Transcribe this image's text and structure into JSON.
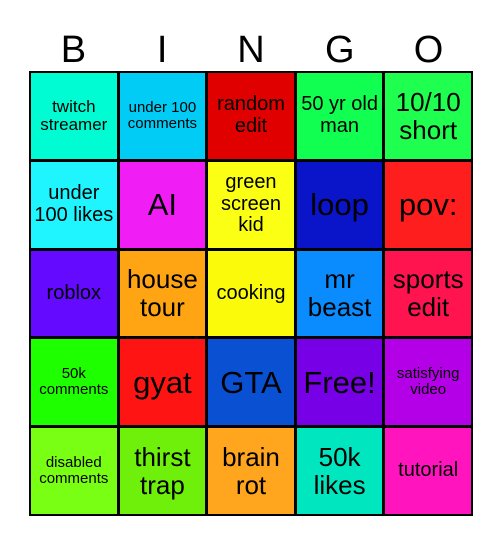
{
  "header": {
    "letters": [
      "B",
      "I",
      "N",
      "G",
      "O"
    ]
  },
  "cells": [
    {
      "text": "twitch streamer",
      "color": "#00FCD2",
      "size": "s-sm"
    },
    {
      "text": "under 100 comments",
      "color": "#00CCF5",
      "size": "s-xs"
    },
    {
      "text": "random edit",
      "color": "#E00000",
      "size": "s-md"
    },
    {
      "text": "50 yr old man",
      "color": "#10FF50",
      "size": "s-md"
    },
    {
      "text": "10/10 short",
      "color": "#1EFF50",
      "size": "s-lg"
    },
    {
      "text": "under 100 likes",
      "color": "#1EF5FF",
      "size": "s-md"
    },
    {
      "text": "AI",
      "color": "#F01EF5",
      "size": "s-xl"
    },
    {
      "text": "green screen kid",
      "color": "#FAFF14",
      "size": "s-md"
    },
    {
      "text": "loop",
      "color": "#0A14C8",
      "size": "s-xl"
    },
    {
      "text": "pov:",
      "color": "#FF1E1E",
      "size": "s-xl"
    },
    {
      "text": "roblox",
      "color": "#640AFF",
      "size": "s-md"
    },
    {
      "text": "house tour",
      "color": "#FFA514",
      "size": "s-lg"
    },
    {
      "text": "cooking",
      "color": "#FAFA0A",
      "size": "s-md"
    },
    {
      "text": "mr beast",
      "color": "#0A8CFF",
      "size": "s-lg"
    },
    {
      "text": "sports edit",
      "color": "#FF1450",
      "size": "s-lg"
    },
    {
      "text": "50k comments",
      "color": "#1EFF00",
      "size": "s-xs"
    },
    {
      "text": "gyat",
      "color": "#FF1414",
      "size": "s-xl"
    },
    {
      "text": "GTA",
      "color": "#0A50D2",
      "size": "s-xl"
    },
    {
      "text": "Free!",
      "color": "#7800E6",
      "size": "s-xl"
    },
    {
      "text": "satisfying video",
      "color": "#B400E6",
      "size": "s-xs"
    },
    {
      "text": "disabled comments",
      "color": "#78FF14",
      "size": "s-xs"
    },
    {
      "text": "thirst trap",
      "color": "#6EF00A",
      "size": "s-lg"
    },
    {
      "text": "brain rot",
      "color": "#FFA51E",
      "size": "s-lg"
    },
    {
      "text": "50k likes",
      "color": "#00E6BE",
      "size": "s-lg"
    },
    {
      "text": "tutorial",
      "color": "#FF14BE",
      "size": "s-md"
    }
  ]
}
